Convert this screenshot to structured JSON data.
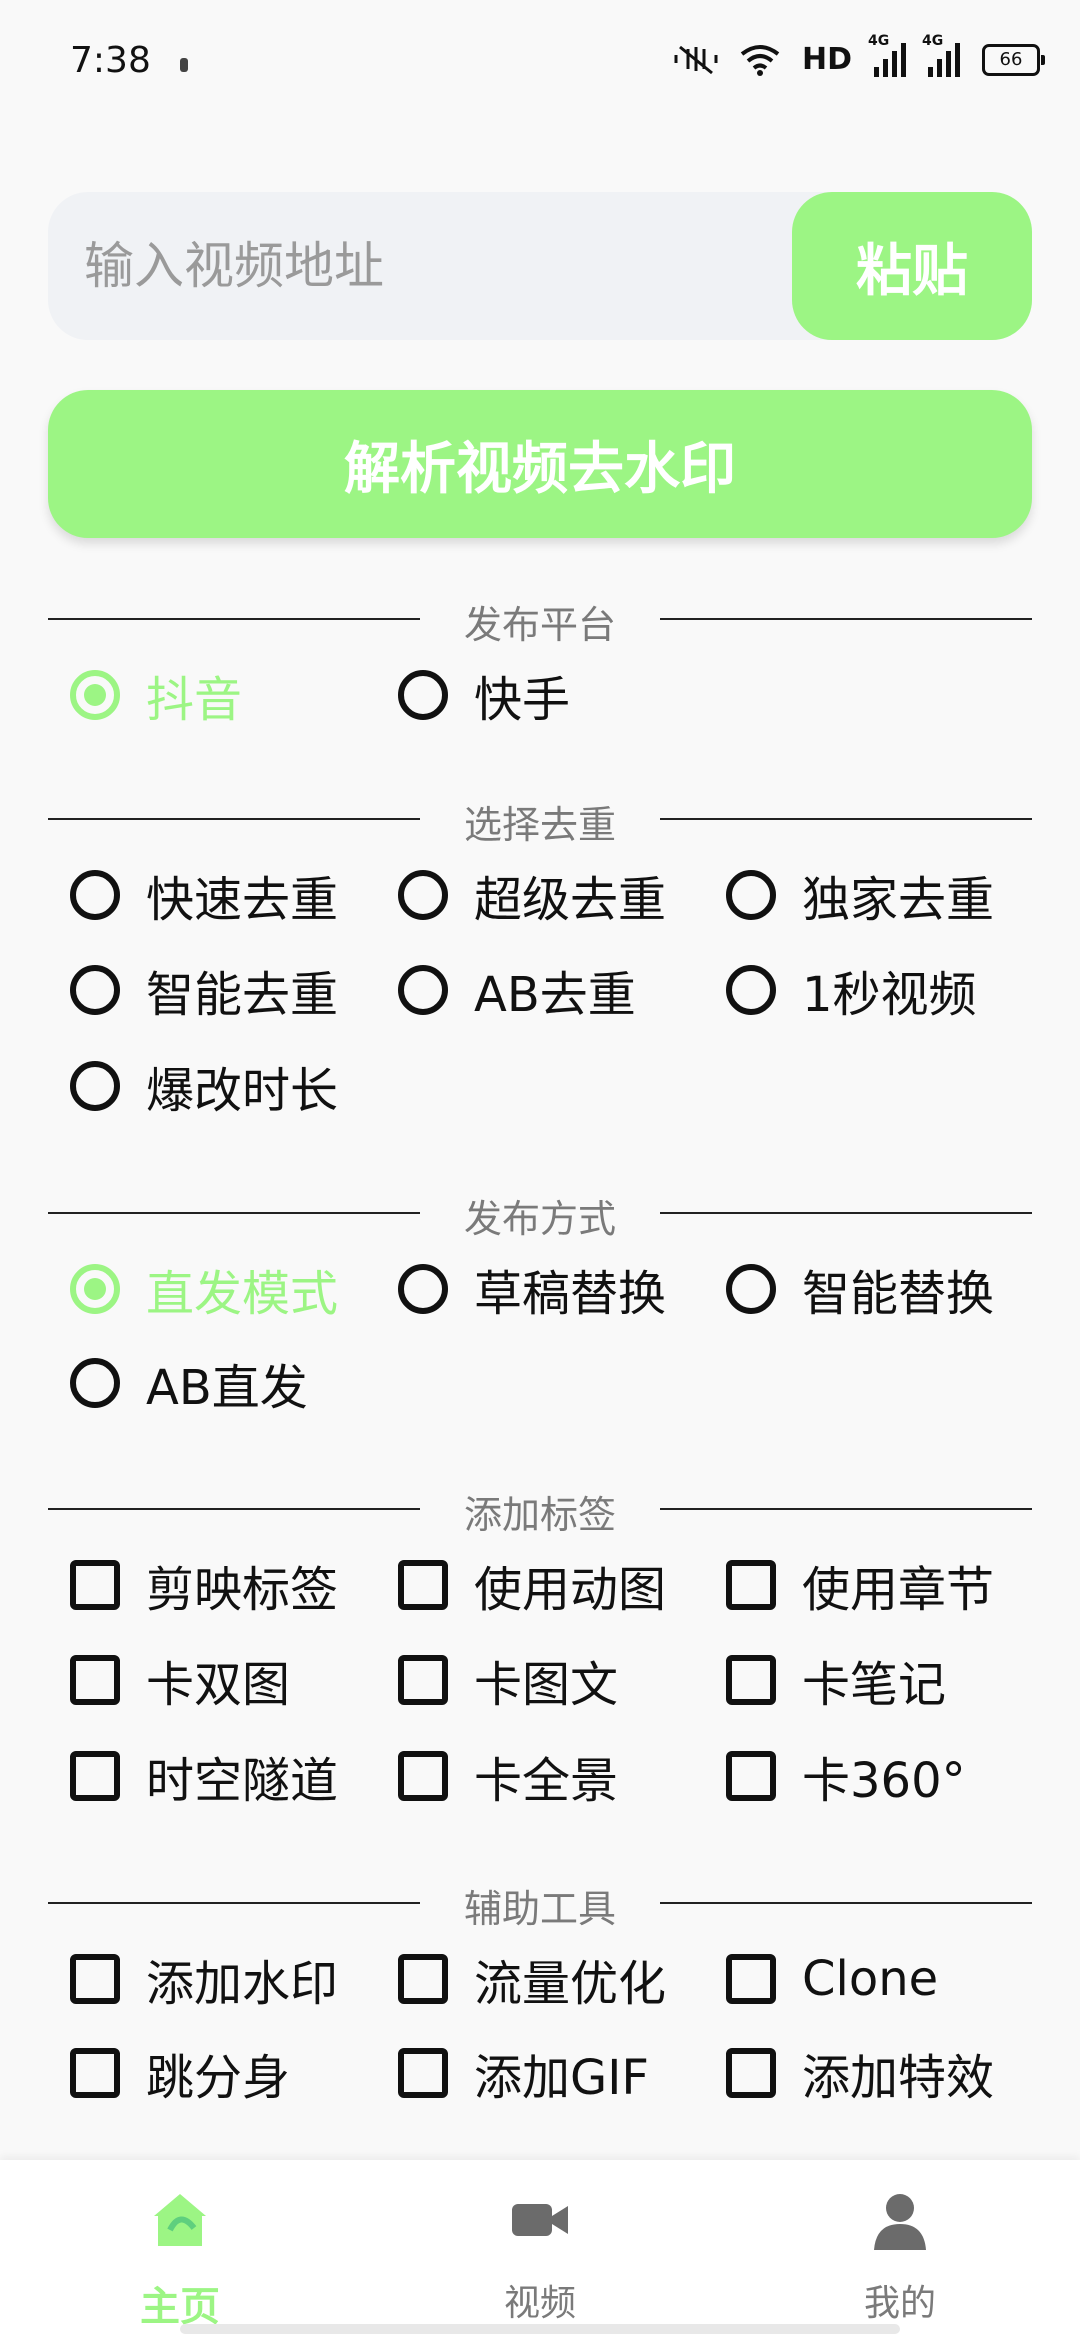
{
  "status_bar": {
    "time": "7:38",
    "network": "HD",
    "signal_1": "4G",
    "signal_2": "4G",
    "battery": "66"
  },
  "url_input": {
    "placeholder": "输入视频地址",
    "paste_label": "粘贴"
  },
  "parse_button": {
    "label": "解析视频去水印"
  },
  "sections": {
    "platform": {
      "title": "发布平台",
      "options": [
        {
          "label": "抖音",
          "checked": true
        },
        {
          "label": "快手",
          "checked": false
        }
      ]
    },
    "dedup": {
      "title": "选择去重",
      "options": [
        {
          "label": "快速去重"
        },
        {
          "label": "超级去重"
        },
        {
          "label": "独家去重"
        },
        {
          "label": "智能去重"
        },
        {
          "label": "AB去重"
        },
        {
          "label": "1秒视频"
        },
        {
          "label": "爆改时长"
        }
      ]
    },
    "publish_mode": {
      "title": "发布方式",
      "options": [
        {
          "label": "直发模式",
          "checked": true
        },
        {
          "label": "草稿替换",
          "checked": false
        },
        {
          "label": "智能替换",
          "checked": false
        },
        {
          "label": "AB直发",
          "checked": false
        }
      ]
    },
    "tags": {
      "title": "添加标签",
      "options": [
        {
          "label": "剪映标签"
        },
        {
          "label": "使用动图"
        },
        {
          "label": "使用章节"
        },
        {
          "label": "卡双图"
        },
        {
          "label": "卡图文"
        },
        {
          "label": "卡笔记"
        },
        {
          "label": "时空隧道"
        },
        {
          "label": "卡全景"
        },
        {
          "label": "卡360°"
        }
      ]
    },
    "tools": {
      "title": "辅助工具",
      "options": [
        {
          "label": "添加水印"
        },
        {
          "label": "流量优化"
        },
        {
          "label": "Clone"
        },
        {
          "label": "跳分身"
        },
        {
          "label": "添加GIF"
        },
        {
          "label": "添加特效"
        }
      ]
    }
  },
  "bottom_nav": {
    "items": [
      {
        "label": "主页",
        "active": true
      },
      {
        "label": "视频",
        "active": false
      },
      {
        "label": "我的",
        "active": false
      }
    ]
  },
  "colors": {
    "accent": "#9cf584",
    "text": "#111111",
    "muted": "#7a7a7a",
    "input_bg": "#f0f2f5"
  },
  "icons": {
    "home": "home-icon",
    "video": "video-camera-icon",
    "profile": "person-icon"
  }
}
